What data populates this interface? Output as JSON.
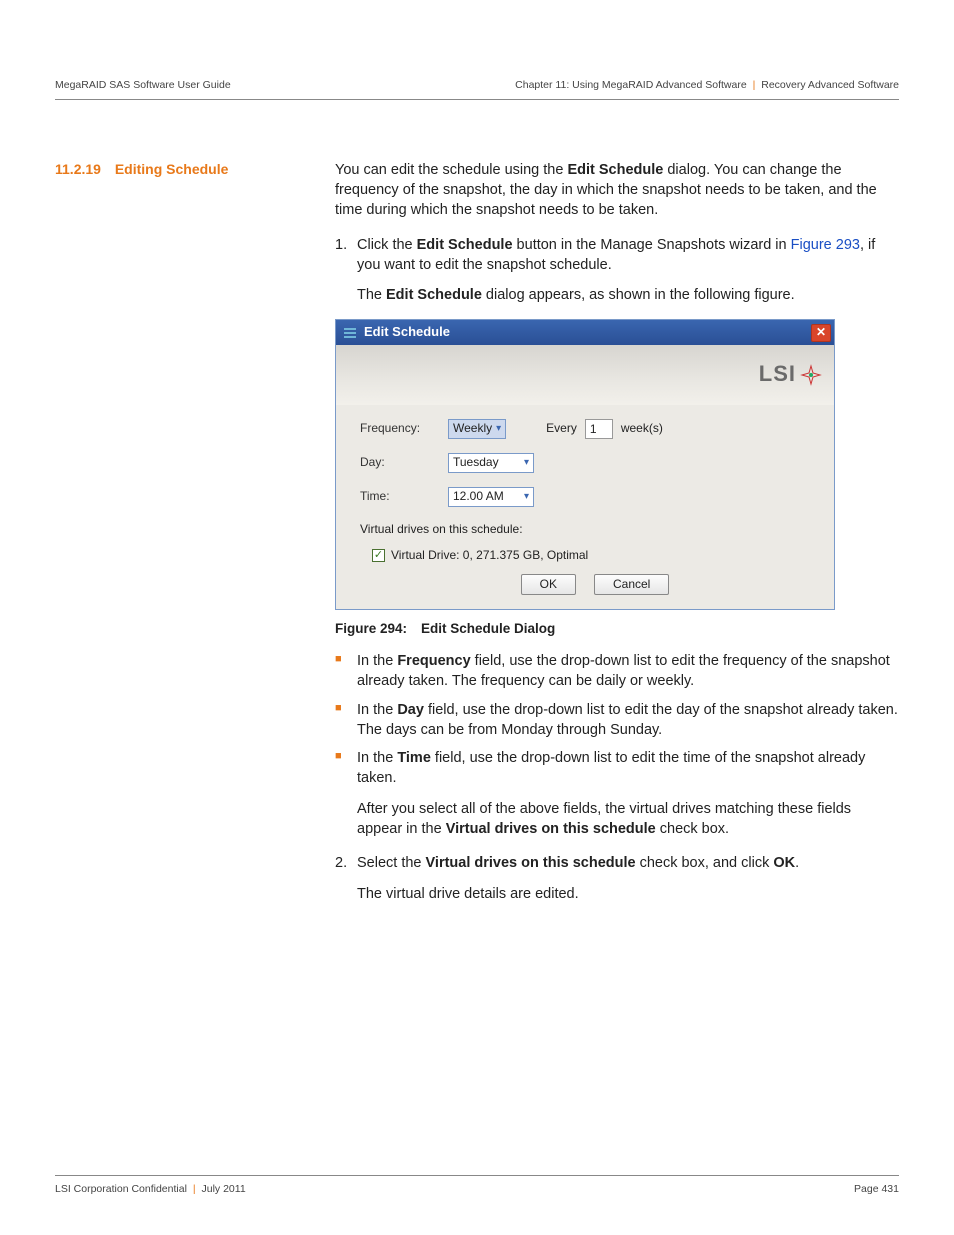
{
  "header": {
    "left": "MegaRAID SAS Software User Guide",
    "right_chapter": "Chapter 11: Using MegaRAID Advanced Software",
    "right_section": "Recovery Advanced Software"
  },
  "section": {
    "number": "11.2.19",
    "title": "Editing Schedule"
  },
  "intro": {
    "p1_a": "You can edit the schedule using the ",
    "p1_b": "Edit Schedule",
    "p1_c": " dialog. You can change the frequency of the snapshot, the day in which the snapshot needs to be taken, and the time during which the snapshot needs to be taken."
  },
  "step1": {
    "num": "1.",
    "a": "Click the ",
    "b": "Edit Schedule",
    "c": " button in the Manage Snapshots wizard in ",
    "link": "Figure 293",
    "d": ", if you want to edit the snapshot schedule.",
    "sub_a": "The ",
    "sub_b": "Edit Schedule",
    "sub_c": " dialog appears, as shown in the following figure."
  },
  "dialog": {
    "title": "Edit Schedule",
    "logo": "LSI",
    "freq_label": "Frequency:",
    "freq_value": "Weekly",
    "every_label": "Every",
    "every_value": "1",
    "every_unit": "week(s)",
    "day_label": "Day:",
    "day_value": "Tuesday",
    "time_label": "Time:",
    "time_value": "12.00 AM",
    "vd_heading": "Virtual drives on this schedule:",
    "vd_item": "Virtual Drive: 0, 271.375 GB, Optimal",
    "ok": "OK",
    "cancel": "Cancel"
  },
  "figcap": {
    "num": "Figure 294:",
    "title": "Edit Schedule Dialog"
  },
  "bullets": {
    "b1_a": "In the ",
    "b1_b": "Frequency",
    "b1_c": " field, use the drop-down list to edit the frequency of the snapshot already taken. The frequency can be daily or weekly.",
    "b2_a": "In the ",
    "b2_b": "Day",
    "b2_c": " field, use the drop-down list to edit the day of the snapshot already taken. The days can be from Monday through Sunday.",
    "b3_a": "In the ",
    "b3_b": "Time",
    "b3_c": " field, use the drop-down list to edit the time of the snapshot already taken."
  },
  "after_bullets": {
    "a": "After you select all of the above fields, the virtual drives matching these fields appear in the ",
    "b": "Virtual drives on this schedule",
    "c": " check box."
  },
  "step2": {
    "num": "2.",
    "a": "Select the ",
    "b": "Virtual drives on this schedule",
    "c": " check box, and click ",
    "d": "OK",
    "e": ".",
    "sub": "The virtual drive details are edited."
  },
  "footer": {
    "left_a": "LSI Corporation Confidential",
    "left_b": "July 2011",
    "right": "Page 431"
  }
}
